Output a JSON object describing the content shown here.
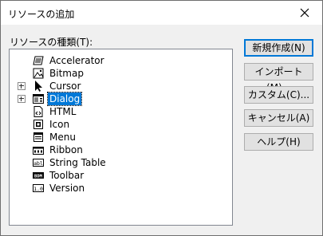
{
  "dialog": {
    "title": "リソースの追加",
    "tree_label": "リソースの種類(T):",
    "tree_items": [
      {
        "label": "Accelerator",
        "icon": "accelerator-icon",
        "expandable": false,
        "selected": false
      },
      {
        "label": "Bitmap",
        "icon": "bitmap-icon",
        "expandable": false,
        "selected": false
      },
      {
        "label": "Cursor",
        "icon": "cursor-icon",
        "expandable": true,
        "selected": false
      },
      {
        "label": "Dialog",
        "icon": "dialog-icon",
        "expandable": true,
        "selected": true
      },
      {
        "label": "HTML",
        "icon": "html-icon",
        "expandable": false,
        "selected": false
      },
      {
        "label": "Icon",
        "icon": "icon-resource-icon",
        "expandable": false,
        "selected": false
      },
      {
        "label": "Menu",
        "icon": "menu-icon",
        "expandable": false,
        "selected": false
      },
      {
        "label": "Ribbon",
        "icon": "ribbon-icon",
        "expandable": false,
        "selected": false
      },
      {
        "label": "String Table",
        "icon": "string-table-icon",
        "expandable": false,
        "selected": false
      },
      {
        "label": "Toolbar",
        "icon": "toolbar-icon",
        "expandable": false,
        "selected": false
      },
      {
        "label": "Version",
        "icon": "version-icon",
        "expandable": false,
        "selected": false
      }
    ],
    "icon_texts": {
      "string_table": "abl",
      "toolbar": "BDM",
      "version": "1.0"
    },
    "buttons": {
      "new": "新規作成(N)",
      "import": "インポート(M)...",
      "custom": "カスタム(C)...",
      "cancel": "キャンセル(A)",
      "help": "ヘルプ(H)"
    },
    "colors": {
      "selection": "#0078d7",
      "default_button_border": "#0078d7"
    }
  }
}
